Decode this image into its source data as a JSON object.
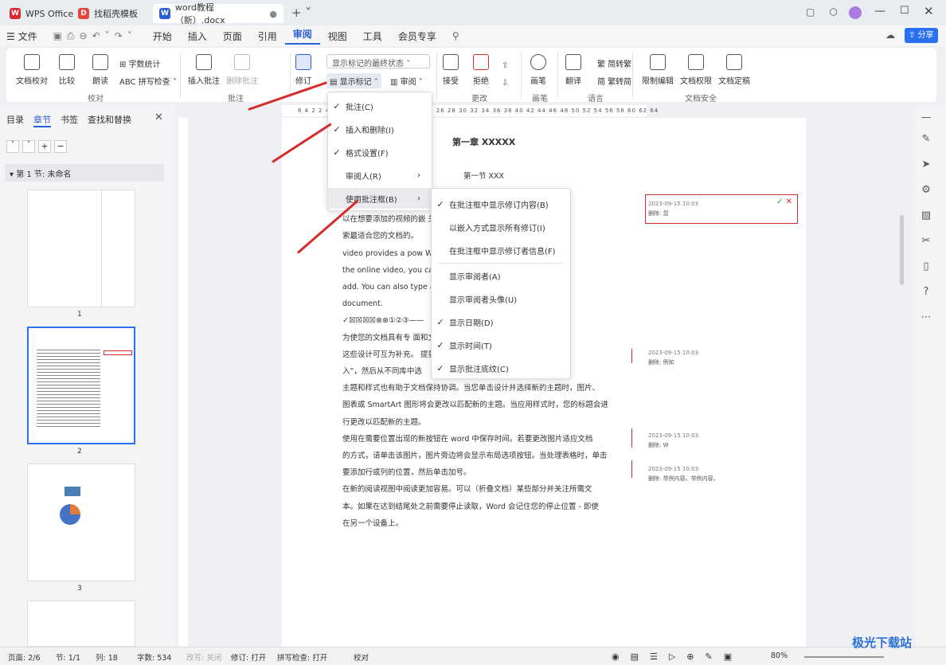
{
  "titlebar": {
    "app": "WPS Office",
    "tab1": "找稻壳模板",
    "tab2": "word教程（新）.docx"
  },
  "menubar": {
    "file": "文件",
    "items": [
      "开始",
      "插入",
      "页面",
      "引用",
      "审阅",
      "视图",
      "工具",
      "会员专享"
    ],
    "share": "分享"
  },
  "ribbon": {
    "proof": "文档校对",
    "compare": "比较",
    "read": "朗读",
    "wordcount": "字数统计",
    "spell": "拼写检查",
    "g1": "校对",
    "insert_comment": "插入批注",
    "delete_comment": "删除批注",
    "g2": "批注",
    "track": "修订",
    "display_state": "显示标记的最终状态",
    "show_markup": "显示标记",
    "review": "审阅",
    "accept": "接受",
    "reject": "拒绝",
    "g3": "更改",
    "pen": "画笔",
    "g4": "画笔",
    "translate": "翻译",
    "trad": "简转繁",
    "simp": "繁转简",
    "g5": "语言",
    "restrict": "限制编辑",
    "perm": "文档权限",
    "final": "文档定稿",
    "g6": "文档安全"
  },
  "sidebar": {
    "tabs": [
      "目录",
      "章节",
      "书签",
      "查找和替换"
    ],
    "section": "第 1 节: 未命名",
    "pages": [
      "1",
      "2",
      "3"
    ]
  },
  "menu1": [
    "批注(C)",
    "插入和删除(I)",
    "格式设置(F)",
    "审阅人(R)",
    "使用批注框(B)"
  ],
  "menu2": [
    "在批注框中显示修订内容(B)",
    "以嵌入方式显示所有修订(I)",
    "在批注框中显示修订者信息(F)",
    "显示审阅者(A)",
    "显示审阅者头像(U)",
    "显示日期(D)",
    "显示时间(T)",
    "显示批注底纹(C)"
  ],
  "ruler": "6 4 2 2 4 6 8 10 12 14 16 18 20 22 24 26 28 30 32 34 36 38 40 42 44 46 48 50 52 54 56 58 60 62 64",
  "doc": {
    "chapter": "第一章 XXXXX",
    "section": "第一节 XXX",
    "lines": [
      "video provides a pow                                    联机视频时，可",
      "以在想要添加的视频的嵌                                   关键字以联机搜",
      "索最适合您的文档的。",
      "    video provides a pow                                    When you click",
      "the online video, you can                                   deo you want to",
      "add. You can also type a                                    hat best fits your",
      "document.",
      "✓☒☒☒☒⊗⊗①②③——",
      "    为使您的文档具有专                                     面和文本框设计，",
      "这些设计可互为补充。              提要栏。单击“插",
      "入”，然后从不同库中选",
      "    主题和样式也有助于文档保持协调。当您单击设计并选择新的主题时，图片、",
      "图表或 SmartArt 图形将会更改以匹配新的主题。当应用样式时，您的标题会进",
      "行更改以匹配新的主题。",
      "    使用在需要位置出现的新按钮在 word 中保存时间。若要更改图片适应文档",
      "的方式，请单击该图片，图片旁边将会显示布局选项按钮。当处理表格时，单击",
      "要添加行或列的位置，然后单击加号。",
      "    在新的阅读视图中阅读更加容易。可以（折叠文档）某些部分并关注所需文",
      "本。如果在达到结尾处之前需要停止读取，Word 会记住您的停止位置 - 即使",
      "在另一个设备上。"
    ]
  },
  "comments": [
    {
      "date": "2023-09-15 10:03",
      "text": "删除: 您"
    },
    {
      "date": "2023-09-15 10:03",
      "text": "删除: 例如"
    },
    {
      "date": "2023-09-15 10:03",
      "text": "删除: W"
    },
    {
      "date": "2023-09-15 10:03",
      "text": "删除: 举例内容。举例内容。"
    }
  ],
  "status": {
    "page": "页面: 2/6",
    "section": "节: 1/1",
    "col": "列: 18",
    "words": "字数: 534",
    "rev": "改写: 关闭",
    "track": "修订: 打开",
    "spell": "拼写检查: 打开",
    "proof": "校对",
    "zoom": "80%"
  },
  "watermark": "极光下载站"
}
